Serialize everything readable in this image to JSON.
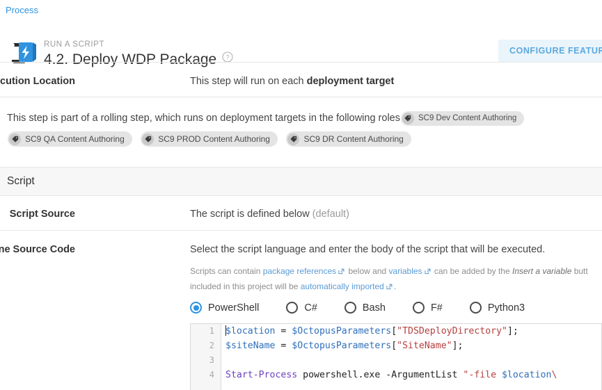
{
  "breadcrumb": {
    "label": "Process"
  },
  "header": {
    "kicker": "RUN A SCRIPT",
    "title": "4.2. Deploy WDP Package",
    "help_icon": "question-mark-circle-icon",
    "step_icon": "script-scroll-lightning-icon",
    "configure_button": "CONFIGURE FEATURES"
  },
  "execution": {
    "label": "Execution Location",
    "value_prefix": "This step will run on each ",
    "value_strong": "deployment target"
  },
  "roles": {
    "intro": "This step is part of a rolling step, which runs on deployment targets in the following roles",
    "tag_icon": "tag-icon",
    "items": [
      "SC9 Dev Content Authoring",
      "SC9 QA Content Authoring",
      "SC9 PROD Content Authoring",
      "SC9 DR Content Authoring"
    ]
  },
  "script_section": {
    "heading": "Script",
    "source_label": "Script Source",
    "source_value": "The script is defined below",
    "source_default": "(default)"
  },
  "inline_source": {
    "label": "Inline Source Code",
    "description": "Select the script language and enter the body of the script that will be executed.",
    "help_line1_a": "Scripts can contain ",
    "help_link1": "package references",
    "help_line1_b": " below and ",
    "help_link2": "variables",
    "help_line1_c": " can be added by the ",
    "help_emphasis": "Insert a variable",
    "help_line1_d": " butt",
    "help_line2_a": "included in this project will be ",
    "help_link3": "automatically imported",
    "help_line2_b": ".",
    "external_link_icon": "external-link-icon",
    "languages": [
      {
        "label": "PowerShell",
        "selected": true
      },
      {
        "label": "C#",
        "selected": false
      },
      {
        "label": "Bash",
        "selected": false
      },
      {
        "label": "F#",
        "selected": false
      },
      {
        "label": "Python3",
        "selected": false
      }
    ]
  },
  "editor": {
    "line_numbers": [
      "1",
      "2",
      "3",
      "4"
    ],
    "lines": [
      "$location = $OctopusParameters[\"TDSDeployDirectory\"];",
      "$siteName = $OctopusParameters[\"SiteName\"];",
      "",
      "Start-Process powershell.exe -ArgumentList \"-file $location\\"
    ]
  },
  "colors": {
    "link": "#2f93e0",
    "accent": "#2f93e0",
    "button_bg": "#eaf4fb",
    "button_text": "#5ba9de",
    "tag_bg": "#e4e4e4",
    "section_bg": "#f7f7f7",
    "code_variable": "#2f6fbb",
    "code_string": "#b5413f",
    "code_command": "#6e3fbf"
  }
}
